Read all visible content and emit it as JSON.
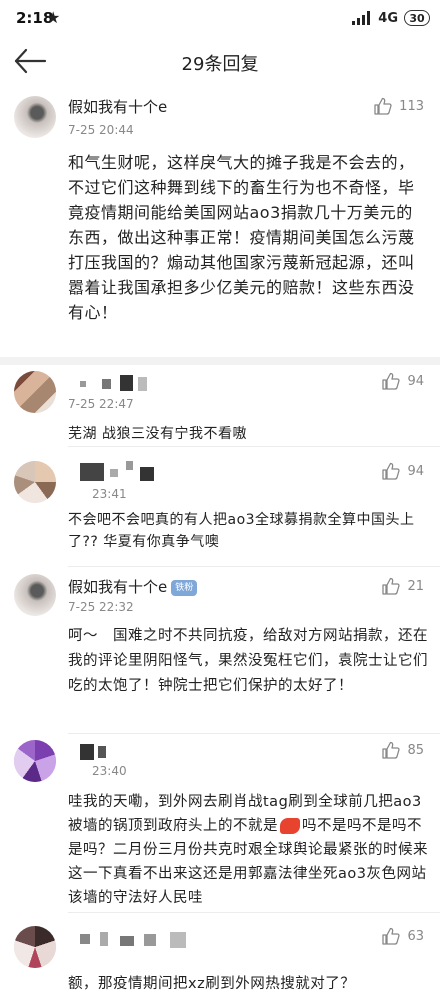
{
  "status_bar": {
    "time": "2:18",
    "network": "4G",
    "battery": "30"
  },
  "header": {
    "title": "29条回复"
  },
  "main_post": {
    "author": "假如我有十个e",
    "time": "7-25 20:44",
    "likes": "113",
    "content": "和气生财呢，这样戾气大的摊子我是不会去的，不过它们这种舞到线下的畜生行为也不奇怪，毕竟疫情期间能给美国网站ao3捐款几十万美元的东西，做出这种事正常！疫情期间美国怎么污蔑打压我国的？煽动其他国家污蔑新冠起源，还叫嚣着让我国承担多少亿美元的赔款！这些东西没有心！"
  },
  "replies": [
    {
      "author": "",
      "time": "7-25 22:47",
      "likes": "94",
      "content": "芜湖 战狼三没有宁我不看嗷"
    },
    {
      "author": "",
      "time": "23:41",
      "likes": "94",
      "content": "不会吧不会吧真的有人把ao3全球募捐款全算中国头上了?? 华夏有你真争气噢"
    },
    {
      "author": "假如我有十个e",
      "badge": "铁粉",
      "time": "7-25 22:32",
      "likes": "21",
      "content": "呵～　国难之时不共同抗疫，给敌对方网站捐款，还在我的评论里阴阳怪气，果然没冤枉它们，袁院士让它们吃的太饱了！钟院士把它们保护的太好了！"
    },
    {
      "author": "",
      "time": "23:40",
      "likes": "85",
      "content_before": "哇我的天嘞，到外网去刷肖战tag刷到全球前几把ao3被墙的锅顶到政府头上的不就是",
      "content_after": "吗不是吗不是吗不是吗？二月份三月份共克时艰全球舆论最紧张的时候来这一下真看不出来这还是用郭嘉法律坐死ao3灰色网站该墙的守法好人民哇"
    },
    {
      "author": "",
      "time": "",
      "likes": "63",
      "content": "额，那疫情期间把xz刷到外网热搜就对了？"
    }
  ]
}
